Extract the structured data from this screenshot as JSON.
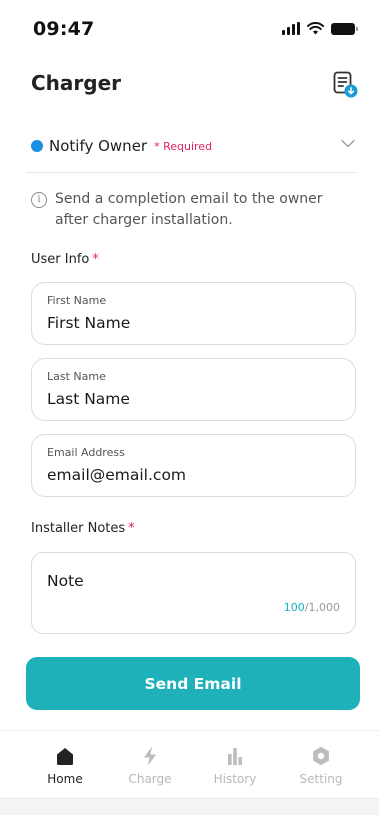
{
  "status_bar": {
    "time": "09:47"
  },
  "header": {
    "title": "Charger",
    "action_icon": "document-download-icon"
  },
  "section": {
    "title": "Notify Owner",
    "required_label": "* Required",
    "indicator_color": "#1a8fe0"
  },
  "info": {
    "text_line1": "Send a completion email to the owner",
    "text_line2": "after charger installation."
  },
  "user_info": {
    "label": "User Info",
    "required_mark": "*",
    "fields": [
      {
        "label": "First Name",
        "value": "First Name"
      },
      {
        "label": "Last Name",
        "value": "Last Name"
      },
      {
        "label": "Email Address",
        "value": "email@email.com"
      }
    ]
  },
  "installer_notes": {
    "label": "Installer Notes",
    "required_mark": "*",
    "value": "Note",
    "count": "100",
    "max": "/1,000"
  },
  "send_button": {
    "label": "Send Email",
    "color": "#1fb1b9"
  },
  "tabs": [
    {
      "label": "Home",
      "icon": "home-icon",
      "active": true
    },
    {
      "label": "Charge",
      "icon": "bolt-icon",
      "active": false
    },
    {
      "label": "History",
      "icon": "bar-chart-icon",
      "active": false
    },
    {
      "label": "Setting",
      "icon": "gear-icon",
      "active": false
    }
  ],
  "colors": {
    "accent": "#1fb1b9",
    "required": "#e0245e",
    "inactive": "#b8b8b8"
  }
}
